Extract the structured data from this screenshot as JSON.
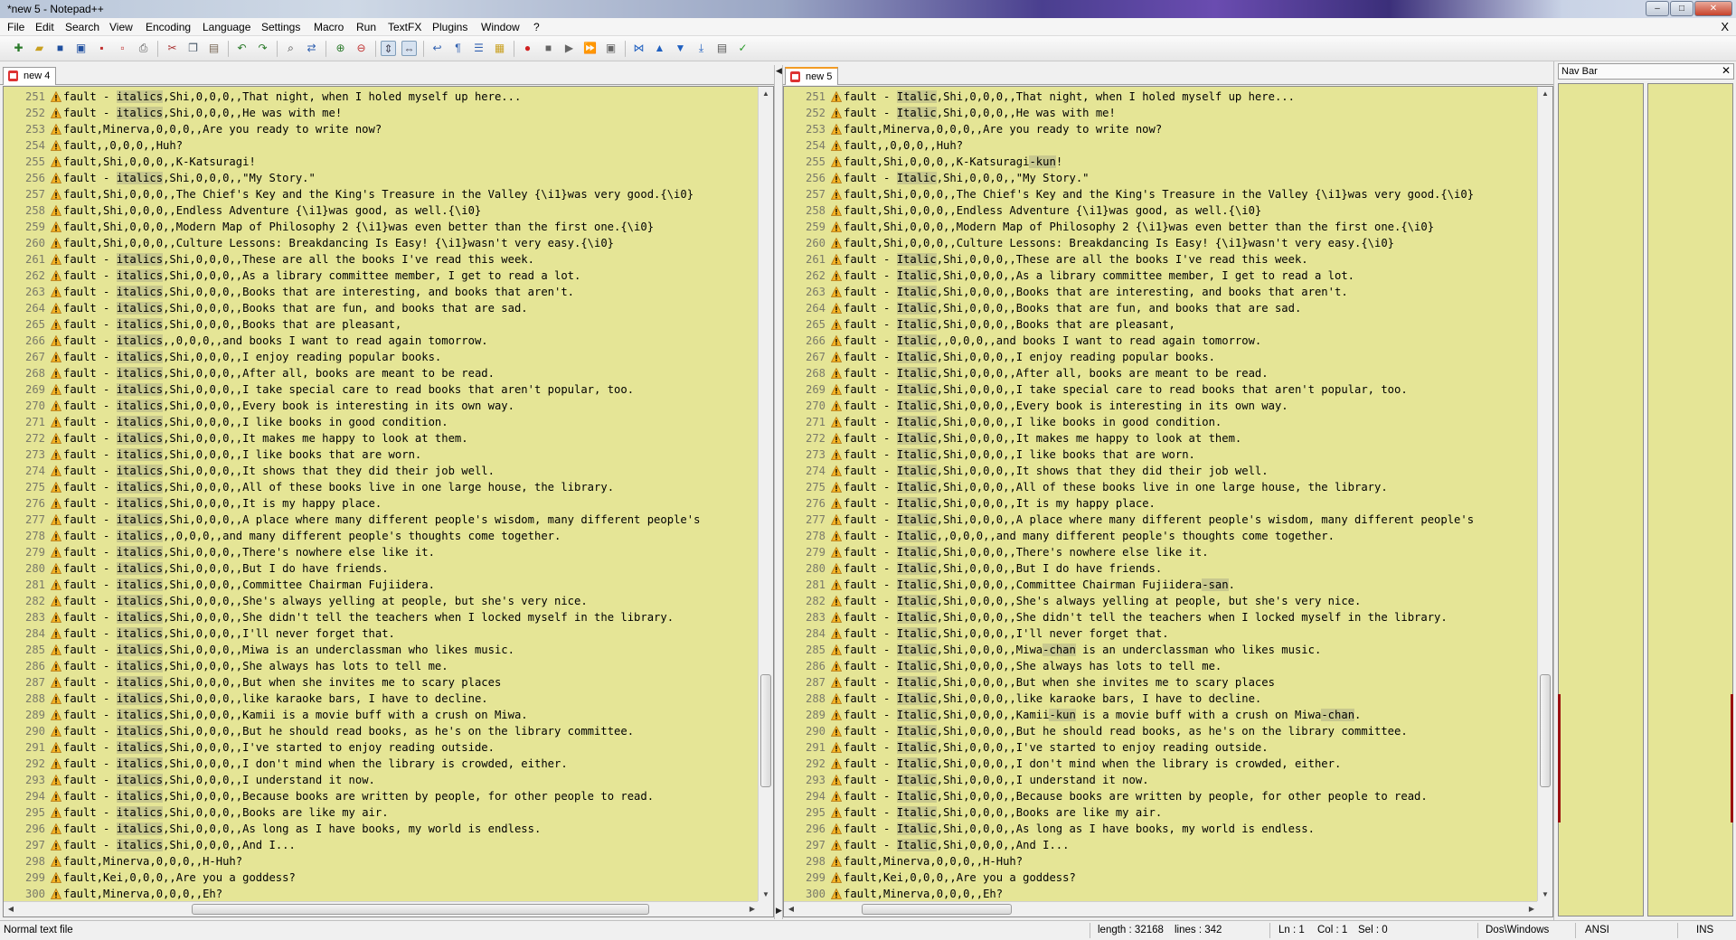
{
  "window": {
    "title": "*new  5 - Notepad++",
    "buttons": {
      "minimize": "–",
      "maximize": "□",
      "close": "✕"
    }
  },
  "menu": {
    "items": [
      "File",
      "Edit",
      "Search",
      "View",
      "Encoding",
      "Language",
      "Settings",
      "Macro",
      "Run",
      "TextFX",
      "Plugins",
      "Window",
      "?"
    ],
    "close": "X"
  },
  "toolbar": {
    "icons": [
      "new-file-icon",
      "open-file-icon",
      "save-icon",
      "save-all-icon",
      "close-icon",
      "close-all-icon",
      "print-icon",
      "cut-icon",
      "copy-icon",
      "paste-icon",
      "undo-icon",
      "redo-icon",
      "find-icon",
      "replace-icon",
      "zoom-in-icon",
      "zoom-out-icon",
      "sync-vertical-icon",
      "sync-horizontal-icon",
      "word-wrap-icon",
      "show-all-chars-icon",
      "indent-guide-icon",
      "user-language-icon",
      "record-macro-icon",
      "stop-record-icon",
      "play-macro-icon",
      "run-multiple-icon",
      "save-macro-icon",
      "compare-icon",
      "prev-diff-icon",
      "next-diff-icon",
      "last-diff-icon",
      "nav-bar-icon",
      "spellcheck-icon"
    ]
  },
  "left_pane": {
    "tab_label": "new  4",
    "highlight_word": "italics",
    "lines": [
      {
        "n": "251",
        "t": "fault - italics,Shi,0,0,0,,That night, when I holed myself up here..."
      },
      {
        "n": "252",
        "t": "fault - italics,Shi,0,0,0,,He was with me!"
      },
      {
        "n": "253",
        "t": "fault,Minerva,0,0,0,,Are you ready to write now?"
      },
      {
        "n": "254",
        "t": "fault,,0,0,0,,Huh?"
      },
      {
        "n": "255",
        "t": "fault,Shi,0,0,0,,K-Katsuragi!"
      },
      {
        "n": "256",
        "t": "fault - italics,Shi,0,0,0,,\"My Story.\""
      },
      {
        "n": "257",
        "t": "fault,Shi,0,0,0,,The Chief's Key and the King's Treasure in the Valley {\\i1}was very good.{\\i0}"
      },
      {
        "n": "258",
        "t": "fault,Shi,0,0,0,,Endless Adventure {\\i1}was good, as well.{\\i0}"
      },
      {
        "n": "259",
        "t": "fault,Shi,0,0,0,,Modern Map of Philosophy 2 {\\i1}was even better than the first one.{\\i0}"
      },
      {
        "n": "260",
        "t": "fault,Shi,0,0,0,,Culture Lessons: Breakdancing Is Easy! {\\i1}wasn't very easy.{\\i0}"
      },
      {
        "n": "261",
        "t": "fault - italics,Shi,0,0,0,,These are all the books I've read this week."
      },
      {
        "n": "262",
        "t": "fault - italics,Shi,0,0,0,,As a library committee member, I get to read a lot."
      },
      {
        "n": "263",
        "t": "fault - italics,Shi,0,0,0,,Books that are interesting, and books that aren't."
      },
      {
        "n": "264",
        "t": "fault - italics,Shi,0,0,0,,Books that are fun, and books that are sad."
      },
      {
        "n": "265",
        "t": "fault - italics,Shi,0,0,0,,Books that are pleasant,"
      },
      {
        "n": "266",
        "t": "fault - italics,,0,0,0,,and books I want to read again tomorrow."
      },
      {
        "n": "267",
        "t": "fault - italics,Shi,0,0,0,,I enjoy reading popular books."
      },
      {
        "n": "268",
        "t": "fault - italics,Shi,0,0,0,,After all, books are meant to be read."
      },
      {
        "n": "269",
        "t": "fault - italics,Shi,0,0,0,,I take special care to read books that aren't popular, too."
      },
      {
        "n": "270",
        "t": "fault - italics,Shi,0,0,0,,Every book is interesting in its own way."
      },
      {
        "n": "271",
        "t": "fault - italics,Shi,0,0,0,,I like books in good condition."
      },
      {
        "n": "272",
        "t": "fault - italics,Shi,0,0,0,,It makes me happy to look at them."
      },
      {
        "n": "273",
        "t": "fault - italics,Shi,0,0,0,,I like books that are worn."
      },
      {
        "n": "274",
        "t": "fault - italics,Shi,0,0,0,,It shows that they did their job well."
      },
      {
        "n": "275",
        "t": "fault - italics,Shi,0,0,0,,All of these books live in one large house, the library."
      },
      {
        "n": "276",
        "t": "fault - italics,Shi,0,0,0,,It is my happy place."
      },
      {
        "n": "277",
        "t": "fault - italics,Shi,0,0,0,,A place where many different people's wisdom, many different people's"
      },
      {
        "n": "278",
        "t": "fault - italics,,0,0,0,,and many different people's thoughts come together."
      },
      {
        "n": "279",
        "t": "fault - italics,Shi,0,0,0,,There's nowhere else like it."
      },
      {
        "n": "280",
        "t": "fault - italics,Shi,0,0,0,,But I do have friends."
      },
      {
        "n": "281",
        "t": "fault - italics,Shi,0,0,0,,Committee Chairman Fujiidera."
      },
      {
        "n": "282",
        "t": "fault - italics,Shi,0,0,0,,She's always yelling at people, but she's very nice."
      },
      {
        "n": "283",
        "t": "fault - italics,Shi,0,0,0,,She didn't tell the teachers when I locked myself in the library."
      },
      {
        "n": "284",
        "t": "fault - italics,Shi,0,0,0,,I'll never forget that."
      },
      {
        "n": "285",
        "t": "fault - italics,Shi,0,0,0,,Miwa is an underclassman who likes music."
      },
      {
        "n": "286",
        "t": "fault - italics,Shi,0,0,0,,She always has lots to tell me."
      },
      {
        "n": "287",
        "t": "fault - italics,Shi,0,0,0,,But when she invites me to scary places"
      },
      {
        "n": "288",
        "t": "fault - italics,Shi,0,0,0,,like karaoke bars, I have to decline."
      },
      {
        "n": "289",
        "t": "fault - italics,Shi,0,0,0,,Kamii is a movie buff with a crush on Miwa."
      },
      {
        "n": "290",
        "t": "fault - italics,Shi,0,0,0,,But he should read books, as he's on the library committee."
      },
      {
        "n": "291",
        "t": "fault - italics,Shi,0,0,0,,I've started to enjoy reading outside."
      },
      {
        "n": "292",
        "t": "fault - italics,Shi,0,0,0,,I don't mind when the library is crowded, either."
      },
      {
        "n": "293",
        "t": "fault - italics,Shi,0,0,0,,I understand it now."
      },
      {
        "n": "294",
        "t": "fault - italics,Shi,0,0,0,,Because books are written by people, for other people to read."
      },
      {
        "n": "295",
        "t": "fault - italics,Shi,0,0,0,,Books are like my air."
      },
      {
        "n": "296",
        "t": "fault - italics,Shi,0,0,0,,As long as I have books, my world is endless."
      },
      {
        "n": "297",
        "t": "fault - italics,Shi,0,0,0,,And I..."
      },
      {
        "n": "298",
        "t": "fault,Minerva,0,0,0,,H-Huh?"
      },
      {
        "n": "299",
        "t": "fault,Kei,0,0,0,,Are you a goddess?"
      },
      {
        "n": "300",
        "t": "fault,Minerva,0,0,0,,Eh?"
      }
    ]
  },
  "right_pane": {
    "tab_label": "new  5",
    "highlight_word": "Italic",
    "lines": [
      {
        "n": "251",
        "t": "fault - Italic,Shi,0,0,0,,That night, when I holed myself up here..."
      },
      {
        "n": "252",
        "t": "fault - Italic,Shi,0,0,0,,He was with me!"
      },
      {
        "n": "253",
        "t": "fault,Minerva,0,0,0,,Are you ready to write now?"
      },
      {
        "n": "254",
        "t": "fault,,0,0,0,,Huh?"
      },
      {
        "n": "255",
        "t": "fault,Shi,0,0,0,,K-Katsuragi-kun!"
      },
      {
        "n": "256",
        "t": "fault - Italic,Shi,0,0,0,,\"My Story.\""
      },
      {
        "n": "257",
        "t": "fault,Shi,0,0,0,,The Chief's Key and the King's Treasure in the Valley {\\i1}was very good.{\\i0}"
      },
      {
        "n": "258",
        "t": "fault,Shi,0,0,0,,Endless Adventure {\\i1}was good, as well.{\\i0}"
      },
      {
        "n": "259",
        "t": "fault,Shi,0,0,0,,Modern Map of Philosophy 2 {\\i1}was even better than the first one.{\\i0}"
      },
      {
        "n": "260",
        "t": "fault,Shi,0,0,0,,Culture Lessons: Breakdancing Is Easy! {\\i1}wasn't very easy.{\\i0}"
      },
      {
        "n": "261",
        "t": "fault - Italic,Shi,0,0,0,,These are all the books I've read this week."
      },
      {
        "n": "262",
        "t": "fault - Italic,Shi,0,0,0,,As a library committee member, I get to read a lot."
      },
      {
        "n": "263",
        "t": "fault - Italic,Shi,0,0,0,,Books that are interesting, and books that aren't."
      },
      {
        "n": "264",
        "t": "fault - Italic,Shi,0,0,0,,Books that are fun, and books that are sad."
      },
      {
        "n": "265",
        "t": "fault - Italic,Shi,0,0,0,,Books that are pleasant,"
      },
      {
        "n": "266",
        "t": "fault - Italic,,0,0,0,,and books I want to read again tomorrow."
      },
      {
        "n": "267",
        "t": "fault - Italic,Shi,0,0,0,,I enjoy reading popular books."
      },
      {
        "n": "268",
        "t": "fault - Italic,Shi,0,0,0,,After all, books are meant to be read."
      },
      {
        "n": "269",
        "t": "fault - Italic,Shi,0,0,0,,I take special care to read books that aren't popular, too."
      },
      {
        "n": "270",
        "t": "fault - Italic,Shi,0,0,0,,Every book is interesting in its own way."
      },
      {
        "n": "271",
        "t": "fault - Italic,Shi,0,0,0,,I like books in good condition."
      },
      {
        "n": "272",
        "t": "fault - Italic,Shi,0,0,0,,It makes me happy to look at them."
      },
      {
        "n": "273",
        "t": "fault - Italic,Shi,0,0,0,,I like books that are worn."
      },
      {
        "n": "274",
        "t": "fault - Italic,Shi,0,0,0,,It shows that they did their job well."
      },
      {
        "n": "275",
        "t": "fault - Italic,Shi,0,0,0,,All of these books live in one large house, the library."
      },
      {
        "n": "276",
        "t": "fault - Italic,Shi,0,0,0,,It is my happy place."
      },
      {
        "n": "277",
        "t": "fault - Italic,Shi,0,0,0,,A place where many different people's wisdom, many different people's"
      },
      {
        "n": "278",
        "t": "fault - Italic,,0,0,0,,and many different people's thoughts come together."
      },
      {
        "n": "279",
        "t": "fault - Italic,Shi,0,0,0,,There's nowhere else like it."
      },
      {
        "n": "280",
        "t": "fault - Italic,Shi,0,0,0,,But I do have friends."
      },
      {
        "n": "281",
        "t": "fault - Italic,Shi,0,0,0,,Committee Chairman Fujiidera-san."
      },
      {
        "n": "282",
        "t": "fault - Italic,Shi,0,0,0,,She's always yelling at people, but she's very nice."
      },
      {
        "n": "283",
        "t": "fault - Italic,Shi,0,0,0,,She didn't tell the teachers when I locked myself in the library."
      },
      {
        "n": "284",
        "t": "fault - Italic,Shi,0,0,0,,I'll never forget that."
      },
      {
        "n": "285",
        "t": "fault - Italic,Shi,0,0,0,,Miwa-chan is an underclassman who likes music."
      },
      {
        "n": "286",
        "t": "fault - Italic,Shi,0,0,0,,She always has lots to tell me."
      },
      {
        "n": "287",
        "t": "fault - Italic,Shi,0,0,0,,But when she invites me to scary places"
      },
      {
        "n": "288",
        "t": "fault - Italic,Shi,0,0,0,,like karaoke bars, I have to decline."
      },
      {
        "n": "289",
        "t": "fault - Italic,Shi,0,0,0,,Kamii-kun is a movie buff with a crush on Miwa-chan."
      },
      {
        "n": "290",
        "t": "fault - Italic,Shi,0,0,0,,But he should read books, as he's on the library committee."
      },
      {
        "n": "291",
        "t": "fault - Italic,Shi,0,0,0,,I've started to enjoy reading outside."
      },
      {
        "n": "292",
        "t": "fault - Italic,Shi,0,0,0,,I don't mind when the library is crowded, either."
      },
      {
        "n": "293",
        "t": "fault - Italic,Shi,0,0,0,,I understand it now."
      },
      {
        "n": "294",
        "t": "fault - Italic,Shi,0,0,0,,Because books are written by people, for other people to read."
      },
      {
        "n": "295",
        "t": "fault - Italic,Shi,0,0,0,,Books are like my air."
      },
      {
        "n": "296",
        "t": "fault - Italic,Shi,0,0,0,,As long as I have books, my world is endless."
      },
      {
        "n": "297",
        "t": "fault - Italic,Shi,0,0,0,,And I..."
      },
      {
        "n": "298",
        "t": "fault,Minerva,0,0,0,,H-Huh?"
      },
      {
        "n": "299",
        "t": "fault,Kei,0,0,0,,Are you a goddess?"
      },
      {
        "n": "300",
        "t": "fault,Minerva,0,0,0,,Eh?"
      }
    ]
  },
  "nav_bar": {
    "title": "Nav Bar",
    "close": "✕"
  },
  "status": {
    "file_type": "Normal text file",
    "length": "length : 32168",
    "lines": "lines : 342",
    "ln": "Ln : 1",
    "col": "Col : 1",
    "sel": "Sel : 0",
    "eol": "Dos\\Windows",
    "encoding": "ANSI",
    "mode": "INS"
  },
  "colors": {
    "editor_bg": "#e5e596",
    "word_highlight": "#c8c88e",
    "warning": "#f0a020",
    "diff_marker": "#9a1010"
  }
}
